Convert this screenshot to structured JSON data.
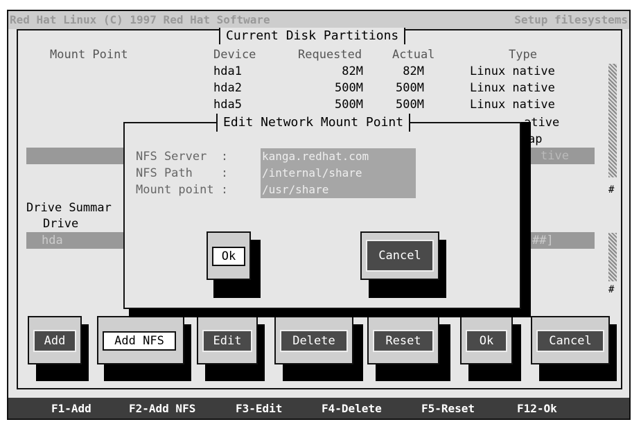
{
  "title_left": "Red Hat Linux (C) 1997 Red Hat Software",
  "title_right": "Setup filesystems",
  "partitions": {
    "title": "Current Disk Partitions",
    "headers": {
      "mount_point": "Mount Point",
      "device": "Device",
      "requested": "Requested",
      "actual": "Actual",
      "type": "Type"
    },
    "rows": [
      {
        "device": "hda1",
        "requested": "82M",
        "actual": "82M",
        "type": "Linux native"
      },
      {
        "device": "hda2",
        "requested": "500M",
        "actual": "500M",
        "type": "Linux native"
      },
      {
        "device": "hda5",
        "requested": "500M",
        "actual": "500M",
        "type": "Linux native"
      }
    ],
    "partial_row4": "ative",
    "partial_row5": "ap",
    "partial_selected": "tive"
  },
  "drive_summary": {
    "label": "Drive Summar",
    "drive_header": "Drive",
    "drive_row": "hda",
    "drive_row_end": "##]"
  },
  "scroll_marker": "#",
  "dialog": {
    "title": "Edit Network Mount Point",
    "fields": [
      {
        "label": "NFS Server  :",
        "value": "kanga.redhat.com"
      },
      {
        "label": "NFS Path    :",
        "value": "/internal/share"
      },
      {
        "label": "Mount point :",
        "value": "/usr/share"
      }
    ],
    "ok": "Ok",
    "cancel": "Cancel"
  },
  "buttons": {
    "add": "Add",
    "add_nfs": "Add NFS",
    "edit": "Edit",
    "delete": "Delete",
    "reset": "Reset",
    "ok": "Ok",
    "cancel": "Cancel"
  },
  "status": {
    "f1": "F1-Add",
    "f2": "F2-Add NFS",
    "f3": "F3-Edit",
    "f4": "F4-Delete",
    "f5": "F5-Reset",
    "f12": "F12-Ok"
  }
}
